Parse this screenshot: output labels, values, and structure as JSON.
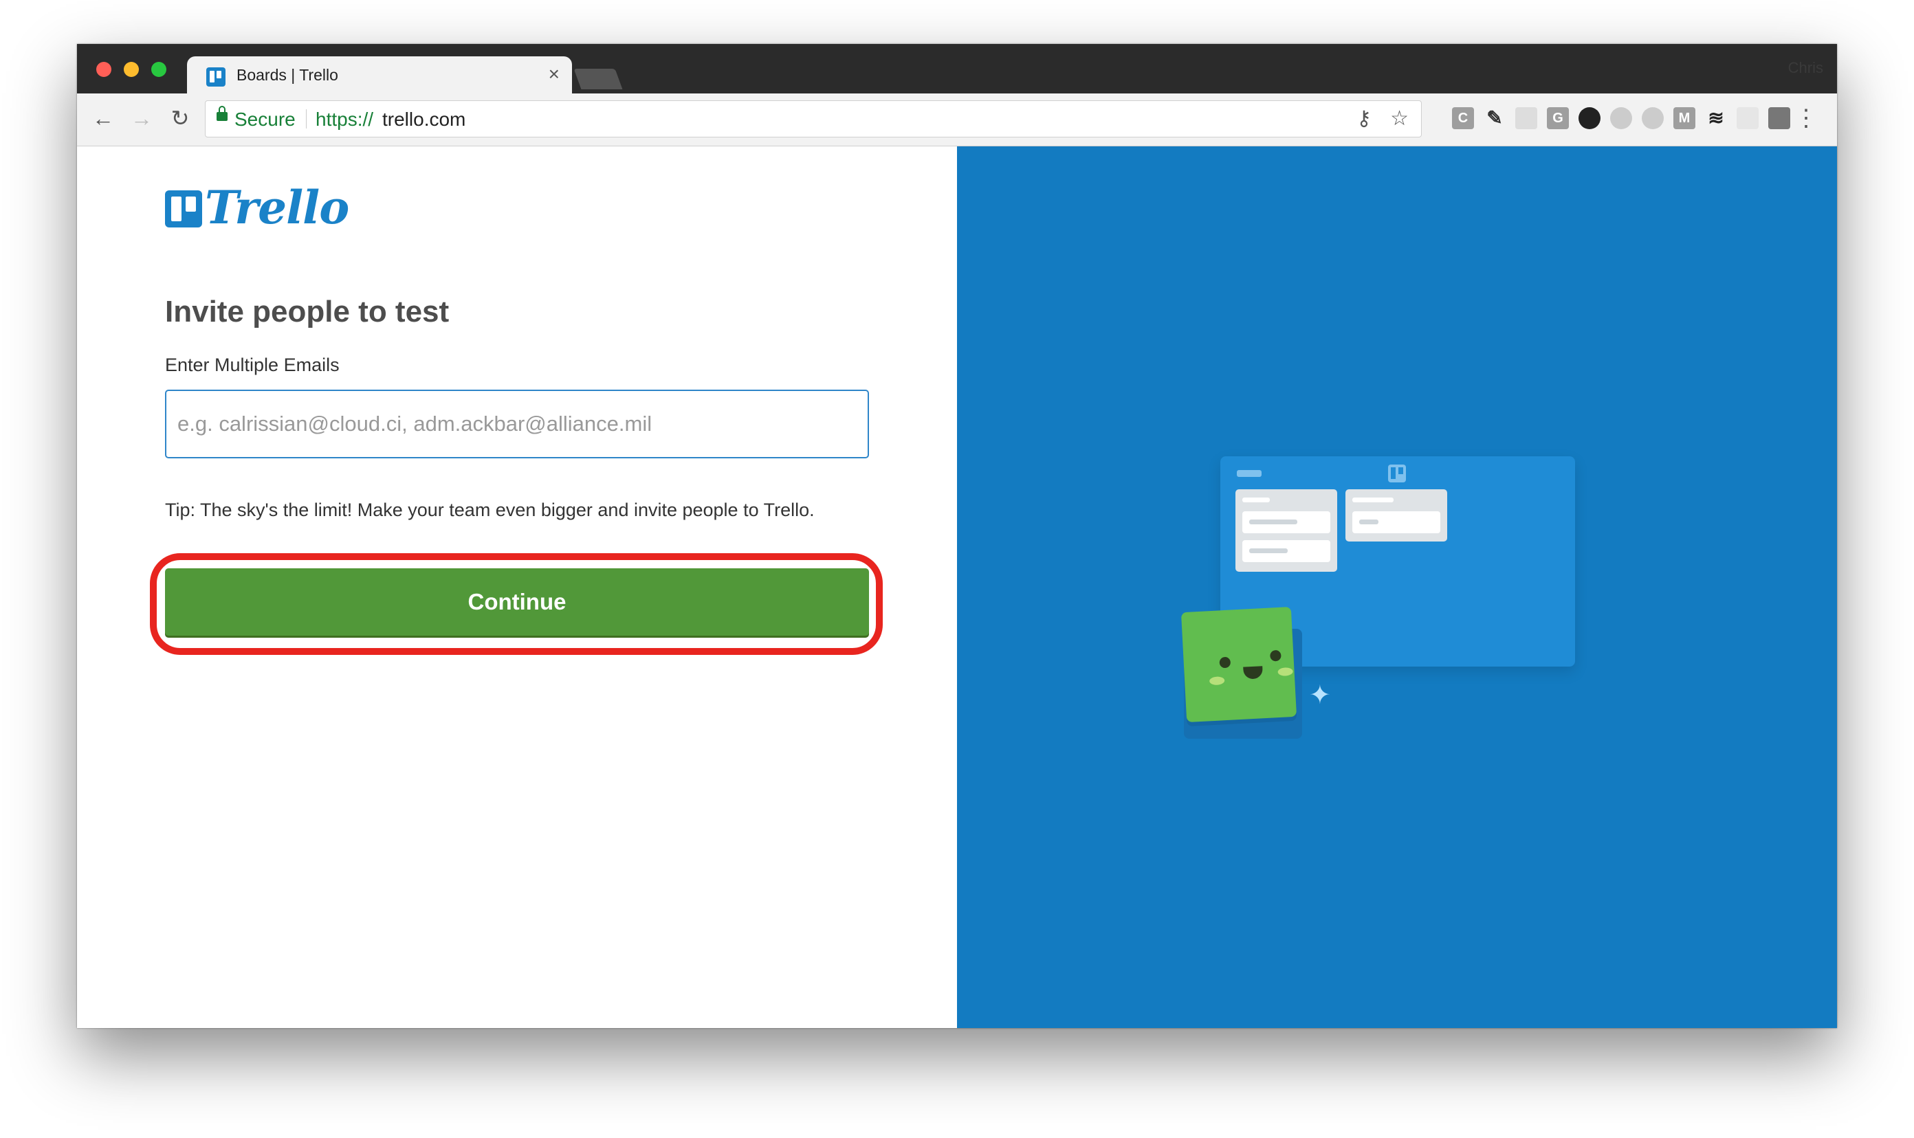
{
  "browser": {
    "tab_title": "Boards | Trello",
    "tab_close": "×",
    "profile_name": "Chris",
    "nav": {
      "back": "←",
      "forward": "→",
      "reload": "↻"
    },
    "omnibox": {
      "secure_label": "Secure",
      "url_scheme": "https://",
      "url_host": "trello.com",
      "key_icon": "key-icon",
      "star_icon": "star-icon"
    },
    "extensions": [
      {
        "name": "C",
        "color": "#9e9e9e"
      },
      {
        "name": "G",
        "color": "#9e9e9e"
      },
      {
        "name": "M",
        "color": "#9e9e9e"
      }
    ],
    "menu": "⋮"
  },
  "page": {
    "logo_text": "Trello",
    "heading": "Invite people to test",
    "email_label": "Enter Multiple Emails",
    "email_placeholder": "e.g. calrissian@cloud.ci, adm.ackbar@alliance.mil",
    "email_value": "",
    "tip": "Tip: The sky's the limit! Make your team even bigger and invite people to Trello.",
    "continue_label": "Continue"
  },
  "colors": {
    "trello_blue": "#1a82c8",
    "panel_blue": "#137bc1",
    "continue_green": "#519839",
    "highlight_red": "#e8251f",
    "secure_green": "#188038"
  }
}
